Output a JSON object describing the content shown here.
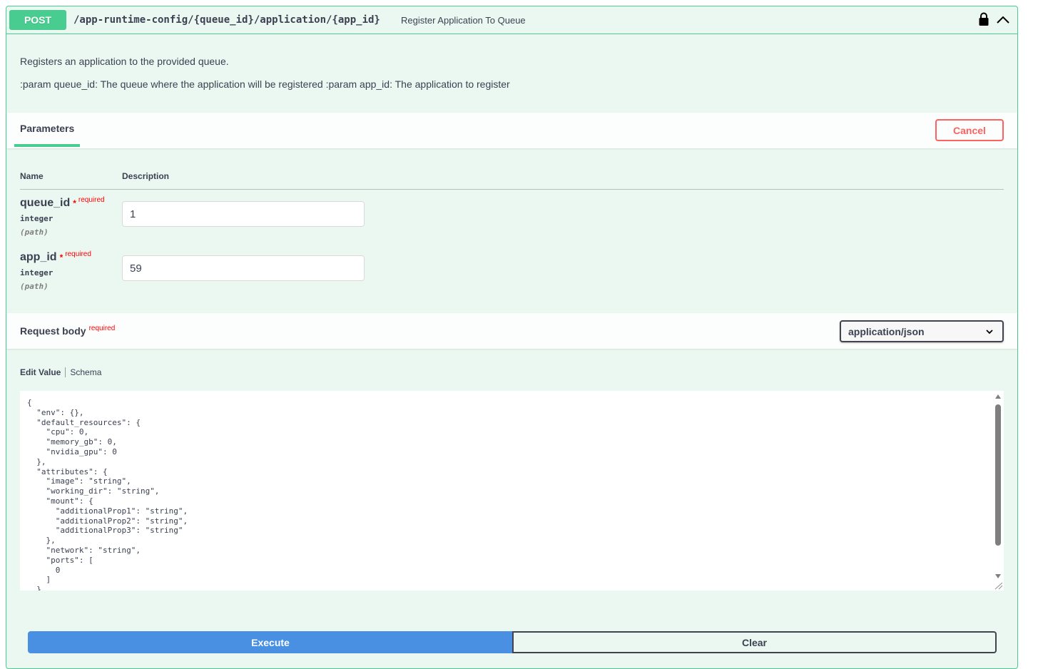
{
  "operation": {
    "method": "POST",
    "path": "/app-runtime-config/{queue_id}/application/{app_id}",
    "summary": "Register Application To Queue",
    "description_line1": "Registers an application to the provided queue.",
    "description_line2": ":param queue_id: The queue where the application will be registered :param app_id: The application to register"
  },
  "parameters": {
    "tab_label": "Parameters",
    "cancel_label": "Cancel",
    "col_name": "Name",
    "col_description": "Description",
    "items": [
      {
        "name": "queue_id",
        "star": "*",
        "required": "required",
        "type": "integer",
        "in": "(path)",
        "value": "1"
      },
      {
        "name": "app_id",
        "star": "*",
        "required": "required",
        "type": "integer",
        "in": "(path)",
        "value": "59"
      }
    ]
  },
  "request_body": {
    "title": "Request body",
    "required": "required",
    "content_type": "application/json",
    "tab_edit_value": "Edit Value",
    "tab_schema": "Schema",
    "code": "{\n  \"env\": {},\n  \"default_resources\": {\n    \"cpu\": 0,\n    \"memory_gb\": 0,\n    \"nvidia_gpu\": 0\n  },\n  \"attributes\": {\n    \"image\": \"string\",\n    \"working_dir\": \"string\",\n    \"mount\": {\n      \"additionalProp1\": \"string\",\n      \"additionalProp2\": \"string\",\n      \"additionalProp3\": \"string\"\n    },\n    \"network\": \"string\",\n    \"ports\": [\n      0\n    ]\n  }"
  },
  "actions": {
    "execute_label": "Execute",
    "clear_label": "Clear"
  },
  "colors": {
    "post_green": "#49cc90",
    "execute_blue": "#4990e2",
    "cancel_red": "#ff6060",
    "required_red": "#ff0000"
  },
  "icons": {
    "lock": "lock-icon",
    "collapse": "chevron-up-icon",
    "select": "chevron-down-icon"
  }
}
